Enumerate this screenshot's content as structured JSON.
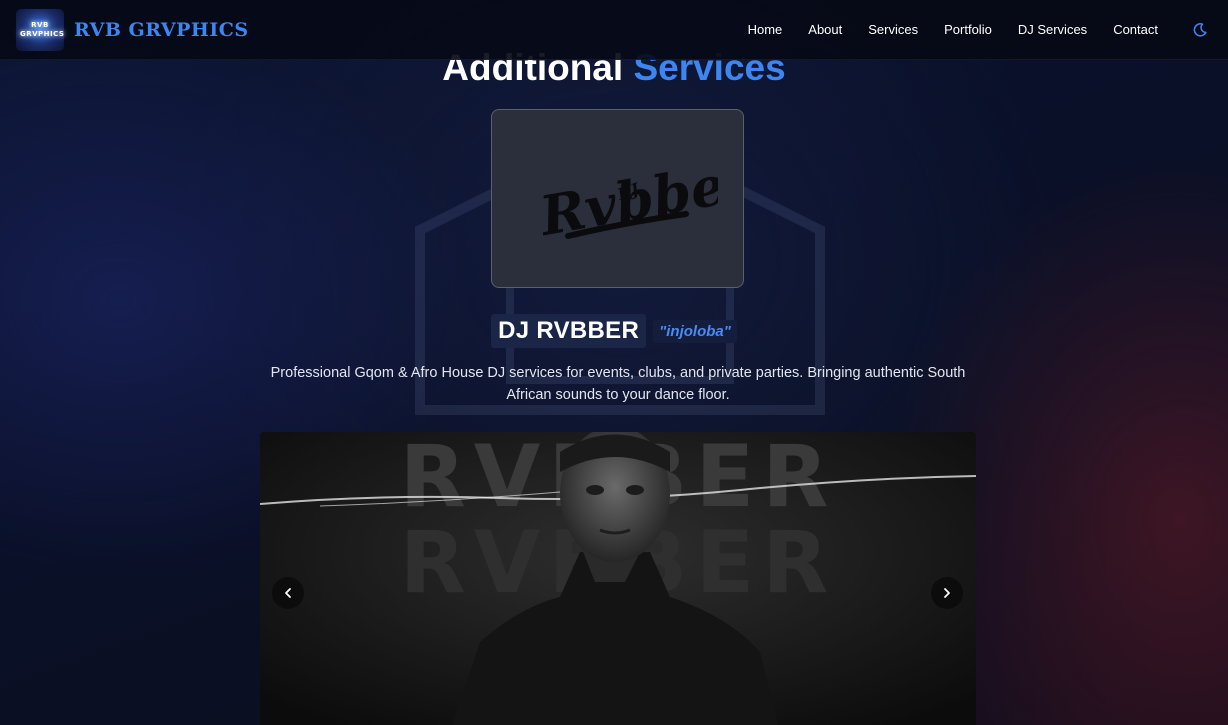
{
  "nav": {
    "logo_text": "RVB GRVPHICS",
    "brand": "RVB GRVPHICS",
    "links": [
      "Home",
      "About",
      "Services",
      "Portfolio",
      "DJ Services",
      "Contact"
    ],
    "theme_icon": "moon-icon"
  },
  "section": {
    "title_main": "Additional",
    "title_accent": "Services"
  },
  "dj": {
    "logo_text": "Rvbber",
    "logo_prefix": "DJ",
    "name": "DJ RVBBER",
    "tagline": "\"injoloba\"",
    "description": "Professional Gqom & Afro House DJ services for events, clubs, and private parties. Bringing authentic South African sounds to your dance floor."
  },
  "carousel": {
    "background_text": "RVBBER",
    "prev_icon": "chevron-left-icon",
    "next_icon": "chevron-right-icon"
  },
  "colors": {
    "accent": "#3d86f2",
    "nav_bg": "#060a16",
    "page_bg": "#0a1029"
  }
}
